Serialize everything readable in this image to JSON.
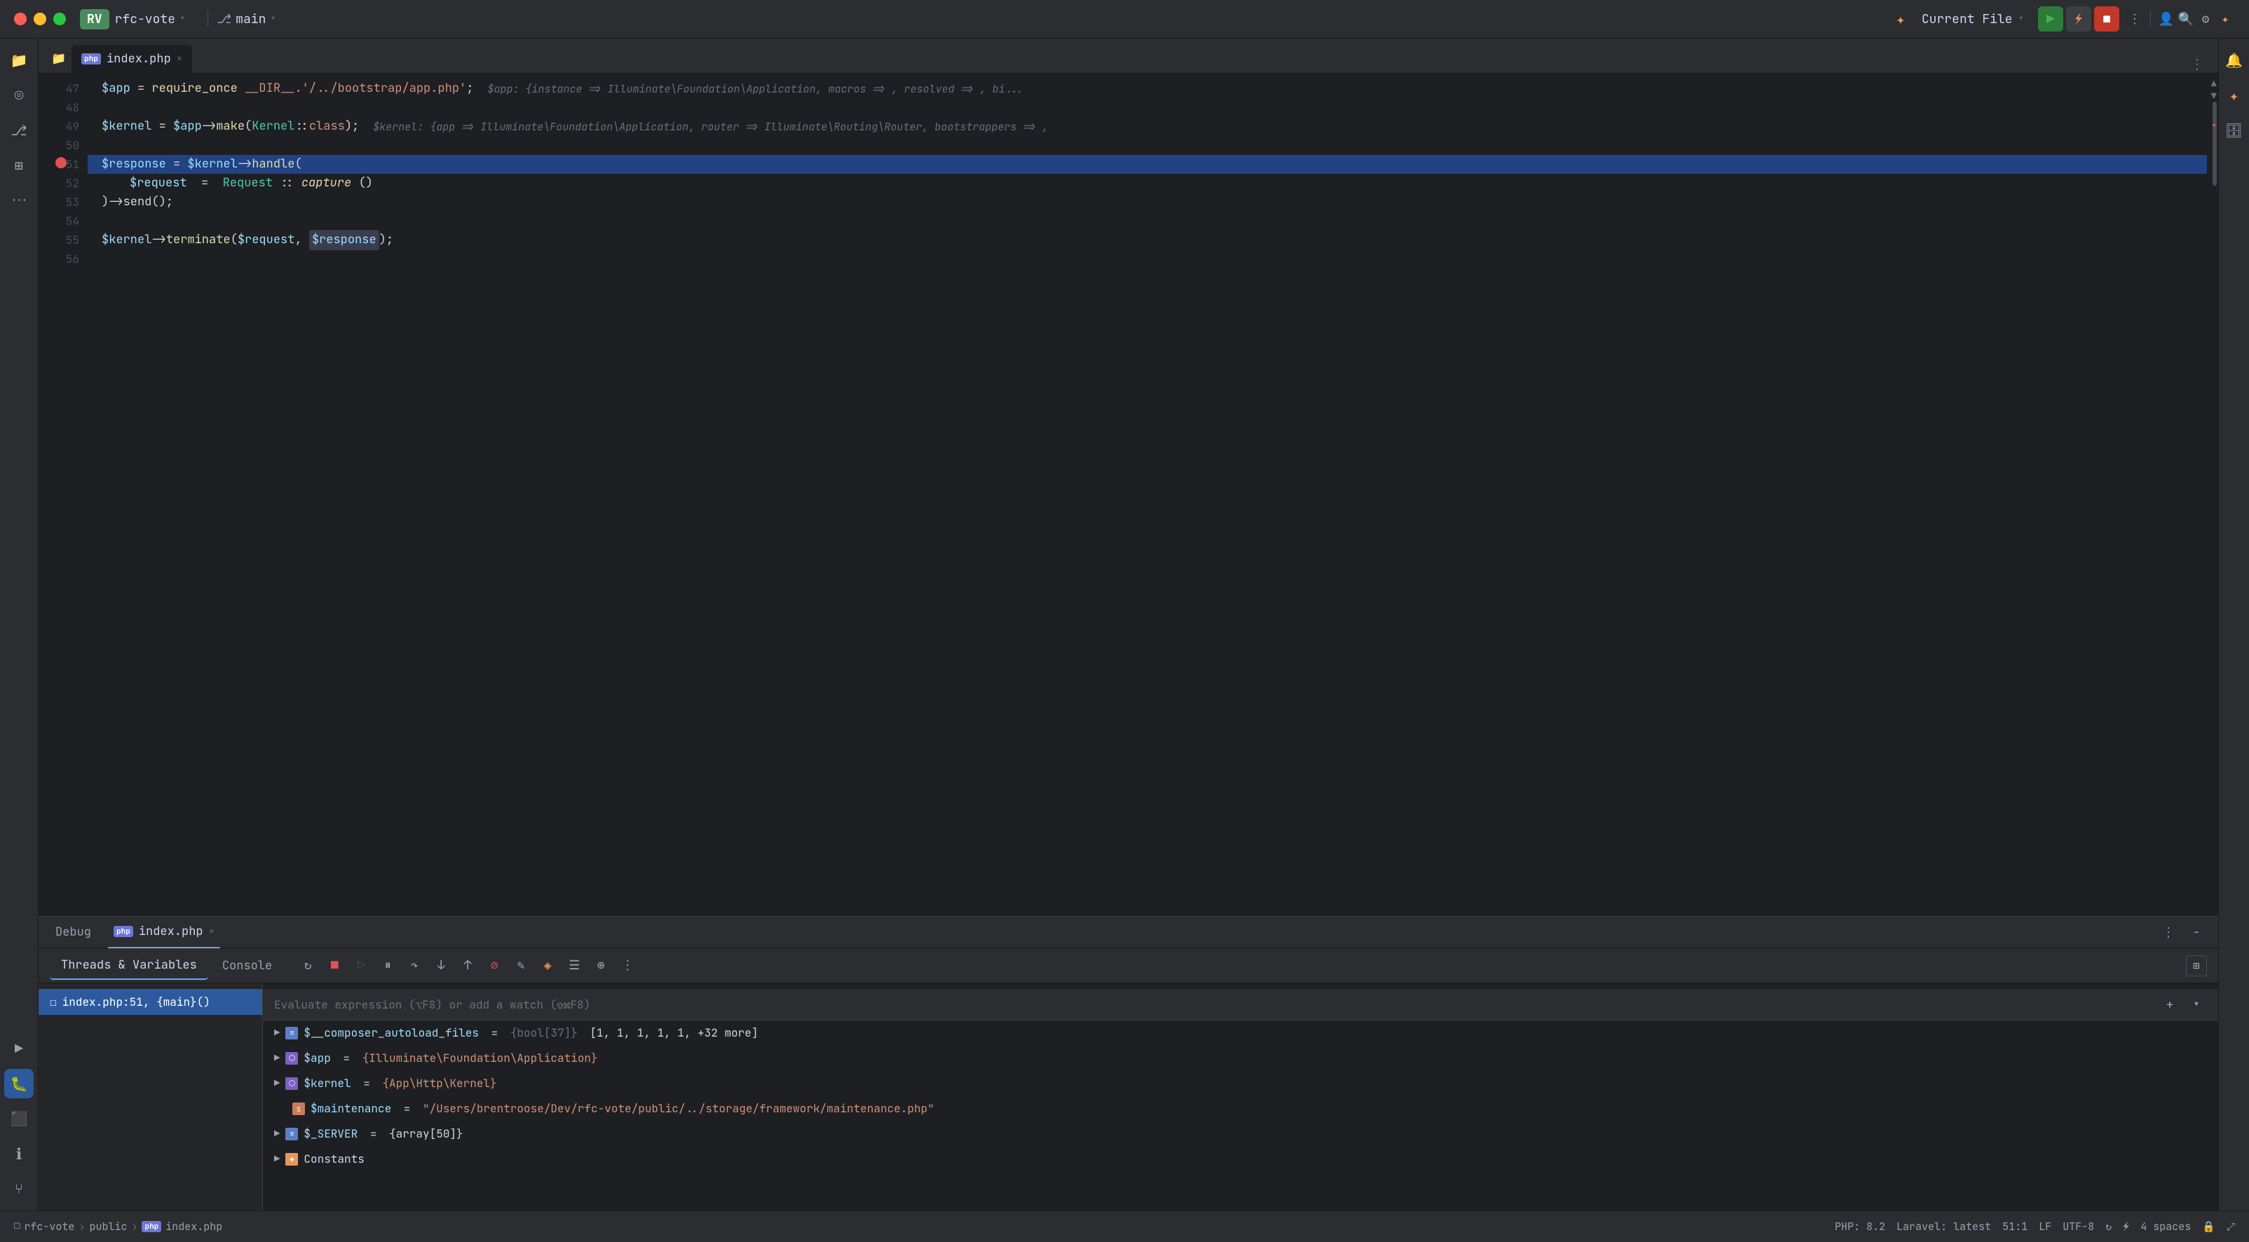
{
  "titlebar": {
    "project_badge": "RV",
    "project_name": "rfc-vote",
    "branch_icon": "⎇",
    "branch_name": "main",
    "current_file_label": "Current File",
    "run_icon": "▶",
    "stop_icon": "■",
    "more_icon": "⋮",
    "account_icon": "👤",
    "search_icon": "🔍",
    "settings_icon": "⚙",
    "ai_icon": "✦"
  },
  "editor": {
    "tab_label": "index.php",
    "tab_close": "×",
    "lines": [
      {
        "num": "47",
        "content": "$app = require_once __DIR__.'/../bootstrap/app.php';",
        "hint": "$app: {instance => Illuminate\\Foundation\\Application, macros => , resolved => , bi..."
      },
      {
        "num": "48",
        "content": ""
      },
      {
        "num": "49",
        "content": "$kernel = $app->make(Kernel::class);",
        "hint": "$kernel: {app => Illuminate\\Foundation\\Application, router => Illuminate\\Routing\\Router, bootstrappers => ,"
      },
      {
        "num": "50",
        "content": ""
      },
      {
        "num": "51",
        "content": "$response = $kernel->handle(",
        "breakpoint": true,
        "current": true
      },
      {
        "num": "52",
        "content": "    $request = Request::capture()"
      },
      {
        "num": "53",
        "content": ")->send();"
      },
      {
        "num": "54",
        "content": ""
      },
      {
        "num": "55",
        "content": "$kernel->terminate($request, $response);",
        "highlight_response": true
      },
      {
        "num": "56",
        "content": ""
      }
    ]
  },
  "debug": {
    "title": "Debug",
    "file_tab": "index.php",
    "tabs": {
      "threads_variables": "Threads & Variables",
      "console": "Console"
    },
    "eval_placeholder": "Evaluate expression (⌥F8) or add a watch (⇧⌘F8)",
    "thread_item": "index.php:51, {main}()",
    "variables": [
      {
        "expand": true,
        "icon": "list",
        "name": "$__composer_autoload_files",
        "eq": "=",
        "type": "{bool[37]}",
        "value": "[1, 1, 1, 1, 1, +32 more]"
      },
      {
        "expand": true,
        "icon": "obj",
        "name": "$app",
        "eq": "=",
        "type": "",
        "value": "{Illuminate\\Foundation\\Application}"
      },
      {
        "expand": true,
        "icon": "obj",
        "name": "$kernel",
        "eq": "=",
        "type": "",
        "value": "{App\\Http\\Kernel}"
      },
      {
        "expand": false,
        "icon": "str-icon",
        "name": "$maintenance",
        "eq": "=",
        "type": "",
        "value": "\"/Users/brentroose/Dev/rfc-vote/public/../storage/framework/maintenance.php\""
      },
      {
        "expand": true,
        "icon": "list",
        "name": "$_SERVER",
        "eq": "=",
        "type": "",
        "value": "{array[50]}"
      },
      {
        "expand": true,
        "icon": "constants",
        "name": "Constants",
        "eq": "",
        "type": "",
        "value": ""
      }
    ]
  },
  "status_bar": {
    "project": "rfc-vote",
    "sep1": ">",
    "dir": "public",
    "sep2": ">",
    "file_icon": "php",
    "file": "index.php",
    "php_version": "PHP: 8.2",
    "laravel": "Laravel: latest",
    "position": "51:1",
    "line_ending": "LF",
    "encoding": "UTF-8",
    "indent": "4 spaces"
  },
  "sidebar": {
    "icons": [
      {
        "name": "folder-icon",
        "glyph": "📁"
      },
      {
        "name": "git-icon",
        "glyph": "◎"
      },
      {
        "name": "branch-icon",
        "glyph": "⎇"
      },
      {
        "name": "extensions-icon",
        "glyph": "⊞"
      },
      {
        "name": "more-icon",
        "glyph": "···"
      },
      {
        "name": "run-sidebar-icon",
        "glyph": "▶"
      },
      {
        "name": "debug-sidebar-icon",
        "glyph": "🐛"
      },
      {
        "name": "terminal-icon",
        "glyph": "⬛"
      },
      {
        "name": "info-icon",
        "glyph": "ℹ"
      },
      {
        "name": "git2-icon",
        "glyph": "⑂"
      }
    ]
  }
}
